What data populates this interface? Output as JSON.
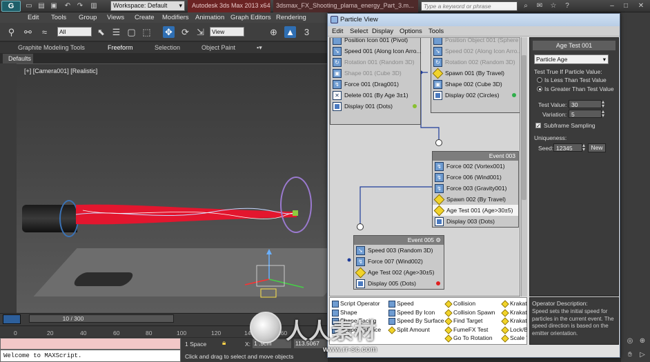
{
  "app": {
    "logo": "G",
    "workspace": "Workspace: Default",
    "title": "Autodesk 3ds Max 2013 x64",
    "file": "3dsmax_FX_Shooting_plama_energy_Part_3.m...",
    "search_placeholder": "Type a keyword or phrase"
  },
  "menubar": [
    "Edit",
    "Tools",
    "Group",
    "Views",
    "Create",
    "Modifiers",
    "Animation",
    "Graph Editors",
    "Rendering"
  ],
  "toolbar": {
    "selection_filter": "All",
    "ref_coord": "View"
  },
  "ribbon": {
    "tabs": [
      "Graphite Modeling Tools",
      "Freeform",
      "Selection",
      "Object Paint"
    ],
    "defaults": "Defaults"
  },
  "viewport": {
    "label": "[+] [Camera001] [Realistic]"
  },
  "timeline": {
    "frame": "10 / 300",
    "ticks": [
      "0",
      "20",
      "40",
      "60",
      "80",
      "100",
      "120",
      "140",
      "160"
    ]
  },
  "maxscript": {
    "output": "Welcome to MAXScript."
  },
  "status": {
    "objects": "1 Space",
    "x_label": "X:",
    "x_value": "1 .9cm",
    "y_value": "113.5067",
    "prompt": "Click and drag to select and move objects"
  },
  "particle_view": {
    "title": "Particle View",
    "menu": [
      "Edit",
      "Select",
      "Display",
      "Options",
      "Tools"
    ],
    "events": [
      {
        "name": "",
        "ops": [
          {
            "label": "Position Icon 001 (Pivot)",
            "icon": "position-icon",
            "dim": false
          },
          {
            "label": "Speed 001 (Along Icon Arro...",
            "icon": "speed-icon",
            "dim": false
          },
          {
            "label": "Rotation 001 (Random 3D)",
            "icon": "rotation-icon",
            "dim": true
          },
          {
            "label": "Shape 001 (Cube 3D)",
            "icon": "shape-icon",
            "dim": true
          },
          {
            "label": "Force 001 (Drag001)",
            "icon": "force-icon",
            "dim": false
          },
          {
            "label": "Delete 001 (By Age 3±1)",
            "icon": "delete-icon",
            "dim": false
          },
          {
            "label": "Display 001 (Dots)",
            "icon": "display-icon",
            "dim": false,
            "dot": "#88c030"
          }
        ]
      },
      {
        "name": "",
        "ops": [
          {
            "label": "Position Object 001 (Sphere",
            "icon": "position-icon",
            "dim": true
          },
          {
            "label": "Speed 002 (Along Icon Arro...",
            "icon": "speed-icon",
            "dim": true
          },
          {
            "label": "Rotation 002 (Random 3D)",
            "icon": "rotation-icon",
            "dim": true
          },
          {
            "label": "Spawn 001 (By Travel)",
            "icon": "spawn-icon",
            "dim": false,
            "test": true
          },
          {
            "label": "Shape 002 (Cube 3D)",
            "icon": "shape-icon",
            "dim": false
          },
          {
            "label": "Display 002 (Circles)",
            "icon": "display-icon",
            "dim": false,
            "dot": "#2fae4a"
          }
        ]
      },
      {
        "name": "Event 003",
        "ops": [
          {
            "label": "Force 002 (Vortex001)",
            "icon": "force-icon",
            "dim": false
          },
          {
            "label": "Force 006 (Wind001)",
            "icon": "force-icon",
            "dim": false
          },
          {
            "label": "Force 003 (Gravity001)",
            "icon": "force-icon",
            "dim": false
          },
          {
            "label": "Spawn 002 (By Travel)",
            "icon": "spawn-icon",
            "dim": false,
            "test": true
          },
          {
            "label": "Age Test 001 (Age>30±5)",
            "icon": "age-test-icon",
            "dim": false,
            "test": true,
            "selected": true
          },
          {
            "label": "Display 003 (Dots)",
            "icon": "display-icon",
            "dim": false
          }
        ]
      },
      {
        "name": "Event 005",
        "ops": [
          {
            "label": "Speed 003 (Random 3D)",
            "icon": "speed-icon",
            "dim": false
          },
          {
            "label": "Force 007 (Wind002)",
            "icon": "force-icon",
            "dim": false
          },
          {
            "label": "Age Test 002 (Age>30±5)",
            "icon": "age-test-icon",
            "dim": false,
            "test": true
          },
          {
            "label": "Display 005 (Dots)",
            "icon": "display-icon",
            "dim": false,
            "dot": "#e02020"
          }
        ]
      }
    ],
    "depot": [
      {
        "label": "Script Operator",
        "test": false
      },
      {
        "label": "Shape",
        "test": false
      },
      {
        "label": "Shape Facing",
        "test": false
      },
      {
        "label": "Shape Instance",
        "test": false
      },
      {
        "label": "Speed",
        "test": false
      },
      {
        "label": "Speed By Icon",
        "test": false
      },
      {
        "label": "Speed By Surface",
        "test": false
      },
      {
        "label": "Split Amount",
        "test": true
      },
      {
        "label": "Collision",
        "test": true
      },
      {
        "label": "Collision Spawn",
        "test": true
      },
      {
        "label": "Find Target",
        "test": true
      },
      {
        "label": "FumeFX Test",
        "test": true
      },
      {
        "label": "Go To Rotation",
        "test": true
      },
      {
        "label": "Krakatoa",
        "test": true
      },
      {
        "label": "Krakatoa",
        "test": true
      },
      {
        "label": "Krakatoa",
        "test": true
      },
      {
        "label": "Lock/Bond",
        "test": true
      },
      {
        "label": "Scale Test",
        "test": true
      }
    ],
    "params": {
      "header": "Age Test 001",
      "test_type": "Particle Age",
      "group_label": "Test True If Particle Value:",
      "options": [
        "Is Less Than Test Value",
        "Is Greater Than Test Value"
      ],
      "selected_option": 1,
      "test_value_label": "Test Value:",
      "test_value": "30",
      "variation_label": "Variation:",
      "variation": "5",
      "subframe_label": "Subframe Sampling",
      "uniqueness_label": "Uniqueness:",
      "seed_label": "Seed:",
      "seed": "12345",
      "new_label": "New"
    },
    "description": {
      "title": "Operator Description:",
      "text": "Speed sets the initial speed for particles in the current event. The speed direction is based on the emitter orientation."
    }
  },
  "watermark": {
    "text": "人人素材",
    "url": "www.rr-sc.com"
  }
}
